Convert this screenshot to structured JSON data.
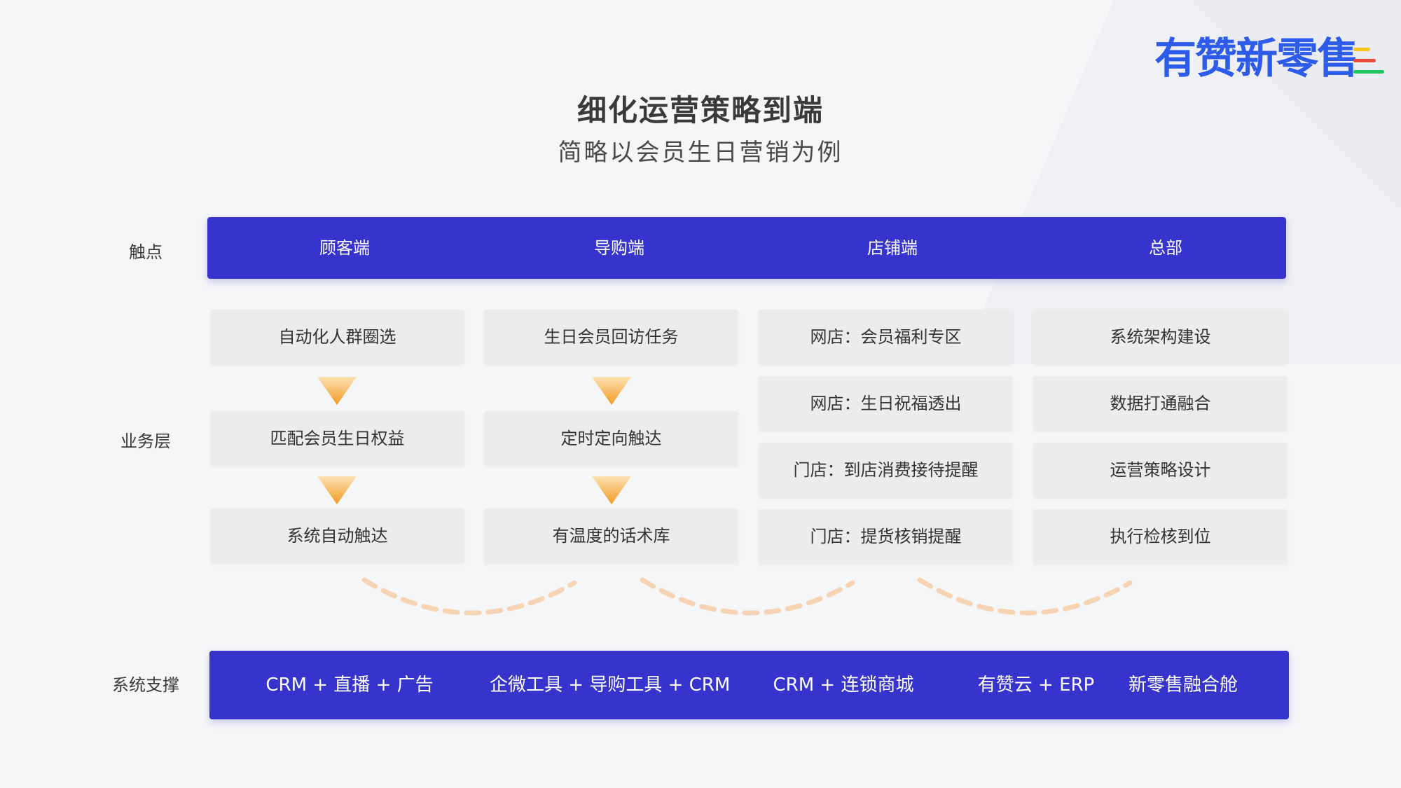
{
  "logo": {
    "text": "有赞新零售"
  },
  "header": {
    "title": "细化运营策略到端",
    "subtitle": "简略以会员生日营销为例"
  },
  "labels": {
    "touchpoint": "触点",
    "business": "业务层",
    "system": "系统支撑"
  },
  "touchpoints": [
    "顾客端",
    "导购端",
    "店铺端",
    "总部"
  ],
  "columns": {
    "customer": [
      "自动化人群圈选",
      "匹配会员生日权益",
      "系统自动触达"
    ],
    "guide": [
      "生日会员回访任务",
      "定时定向触达",
      "有温度的话术库"
    ],
    "store": [
      "网店：会员福利专区",
      "网店：生日祝福透出",
      "门店：到店消费接待提醒",
      "门店：提货核销提醒"
    ],
    "hq": [
      "系统架构建设",
      "数据打通融合",
      "运营策略设计",
      "执行检核到位"
    ]
  },
  "systems": [
    "CRM + 直播 + 广告",
    "企微工具 + 导购工具 + CRM",
    "CRM + 连锁商城",
    "有赞云 + ERP",
    "新零售融合舱"
  ],
  "colors": {
    "primary": "#3634cc",
    "logo": "#2d5bea",
    "arrow_top": "#fde1b4",
    "arrow_bottom": "#f29a22",
    "arc": "#f6d3b3",
    "box": "#ececed"
  }
}
